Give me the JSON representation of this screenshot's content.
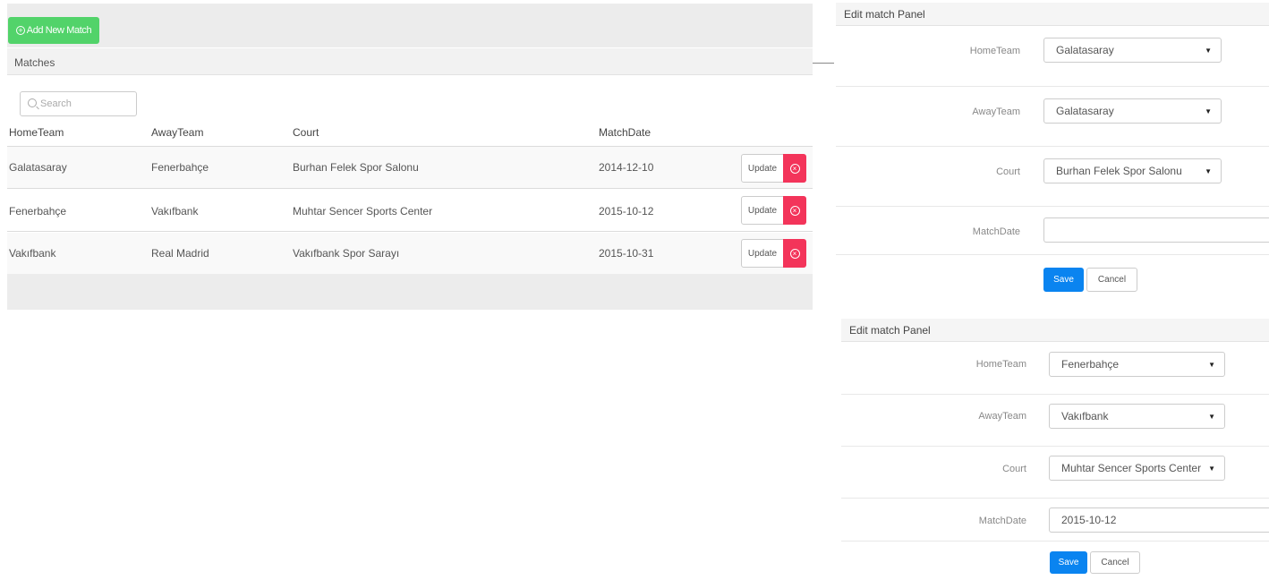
{
  "toolbar": {
    "add_label": "Add New Match"
  },
  "matches": {
    "title": "Matches",
    "search_placeholder": "Search",
    "columns": [
      "HomeTeam",
      "AwayTeam",
      "Court",
      "MatchDate"
    ],
    "rows": [
      {
        "home": "Galatasaray",
        "away": "Fenerbahçe",
        "court": "Burhan Felek Spor Salonu",
        "date": "2014-12-10",
        "update_label": "Update"
      },
      {
        "home": "Fenerbahçe",
        "away": "Vakıfbank",
        "court": "Muhtar Sencer Sports Center",
        "date": "2015-10-12",
        "update_label": "Update"
      },
      {
        "home": "Vakıfbank",
        "away": "Real Madrid",
        "court": "Vakıfbank Spor Sarayı",
        "date": "2015-10-31",
        "update_label": "Update"
      }
    ]
  },
  "edit_panels": [
    {
      "title": "Edit match Panel",
      "labels": {
        "home": "HomeTeam",
        "away": "AwayTeam",
        "court": "Court",
        "date": "MatchDate"
      },
      "values": {
        "home": "Galatasaray",
        "away": "Galatasaray",
        "court": "Burhan Felek Spor Salonu",
        "date": ""
      },
      "save_label": "Save",
      "cancel_label": "Cancel"
    },
    {
      "title": "Edit match Panel",
      "labels": {
        "home": "HomeTeam",
        "away": "AwayTeam",
        "court": "Court",
        "date": "MatchDate"
      },
      "values": {
        "home": "Fenerbahçe",
        "away": "Vakıfbank",
        "court": "Muhtar Sencer Sports Center",
        "date": "2015-10-12"
      },
      "save_label": "Save",
      "cancel_label": "Cancel"
    }
  ],
  "colors": {
    "add_button": "#52d36a",
    "delete_button": "#f3345a",
    "save_button": "#0a84f0"
  },
  "icons": {
    "add": "plus-circle-icon",
    "search": "search-icon",
    "delete": "close-circle-icon",
    "dropdown": "caret-down-icon"
  }
}
